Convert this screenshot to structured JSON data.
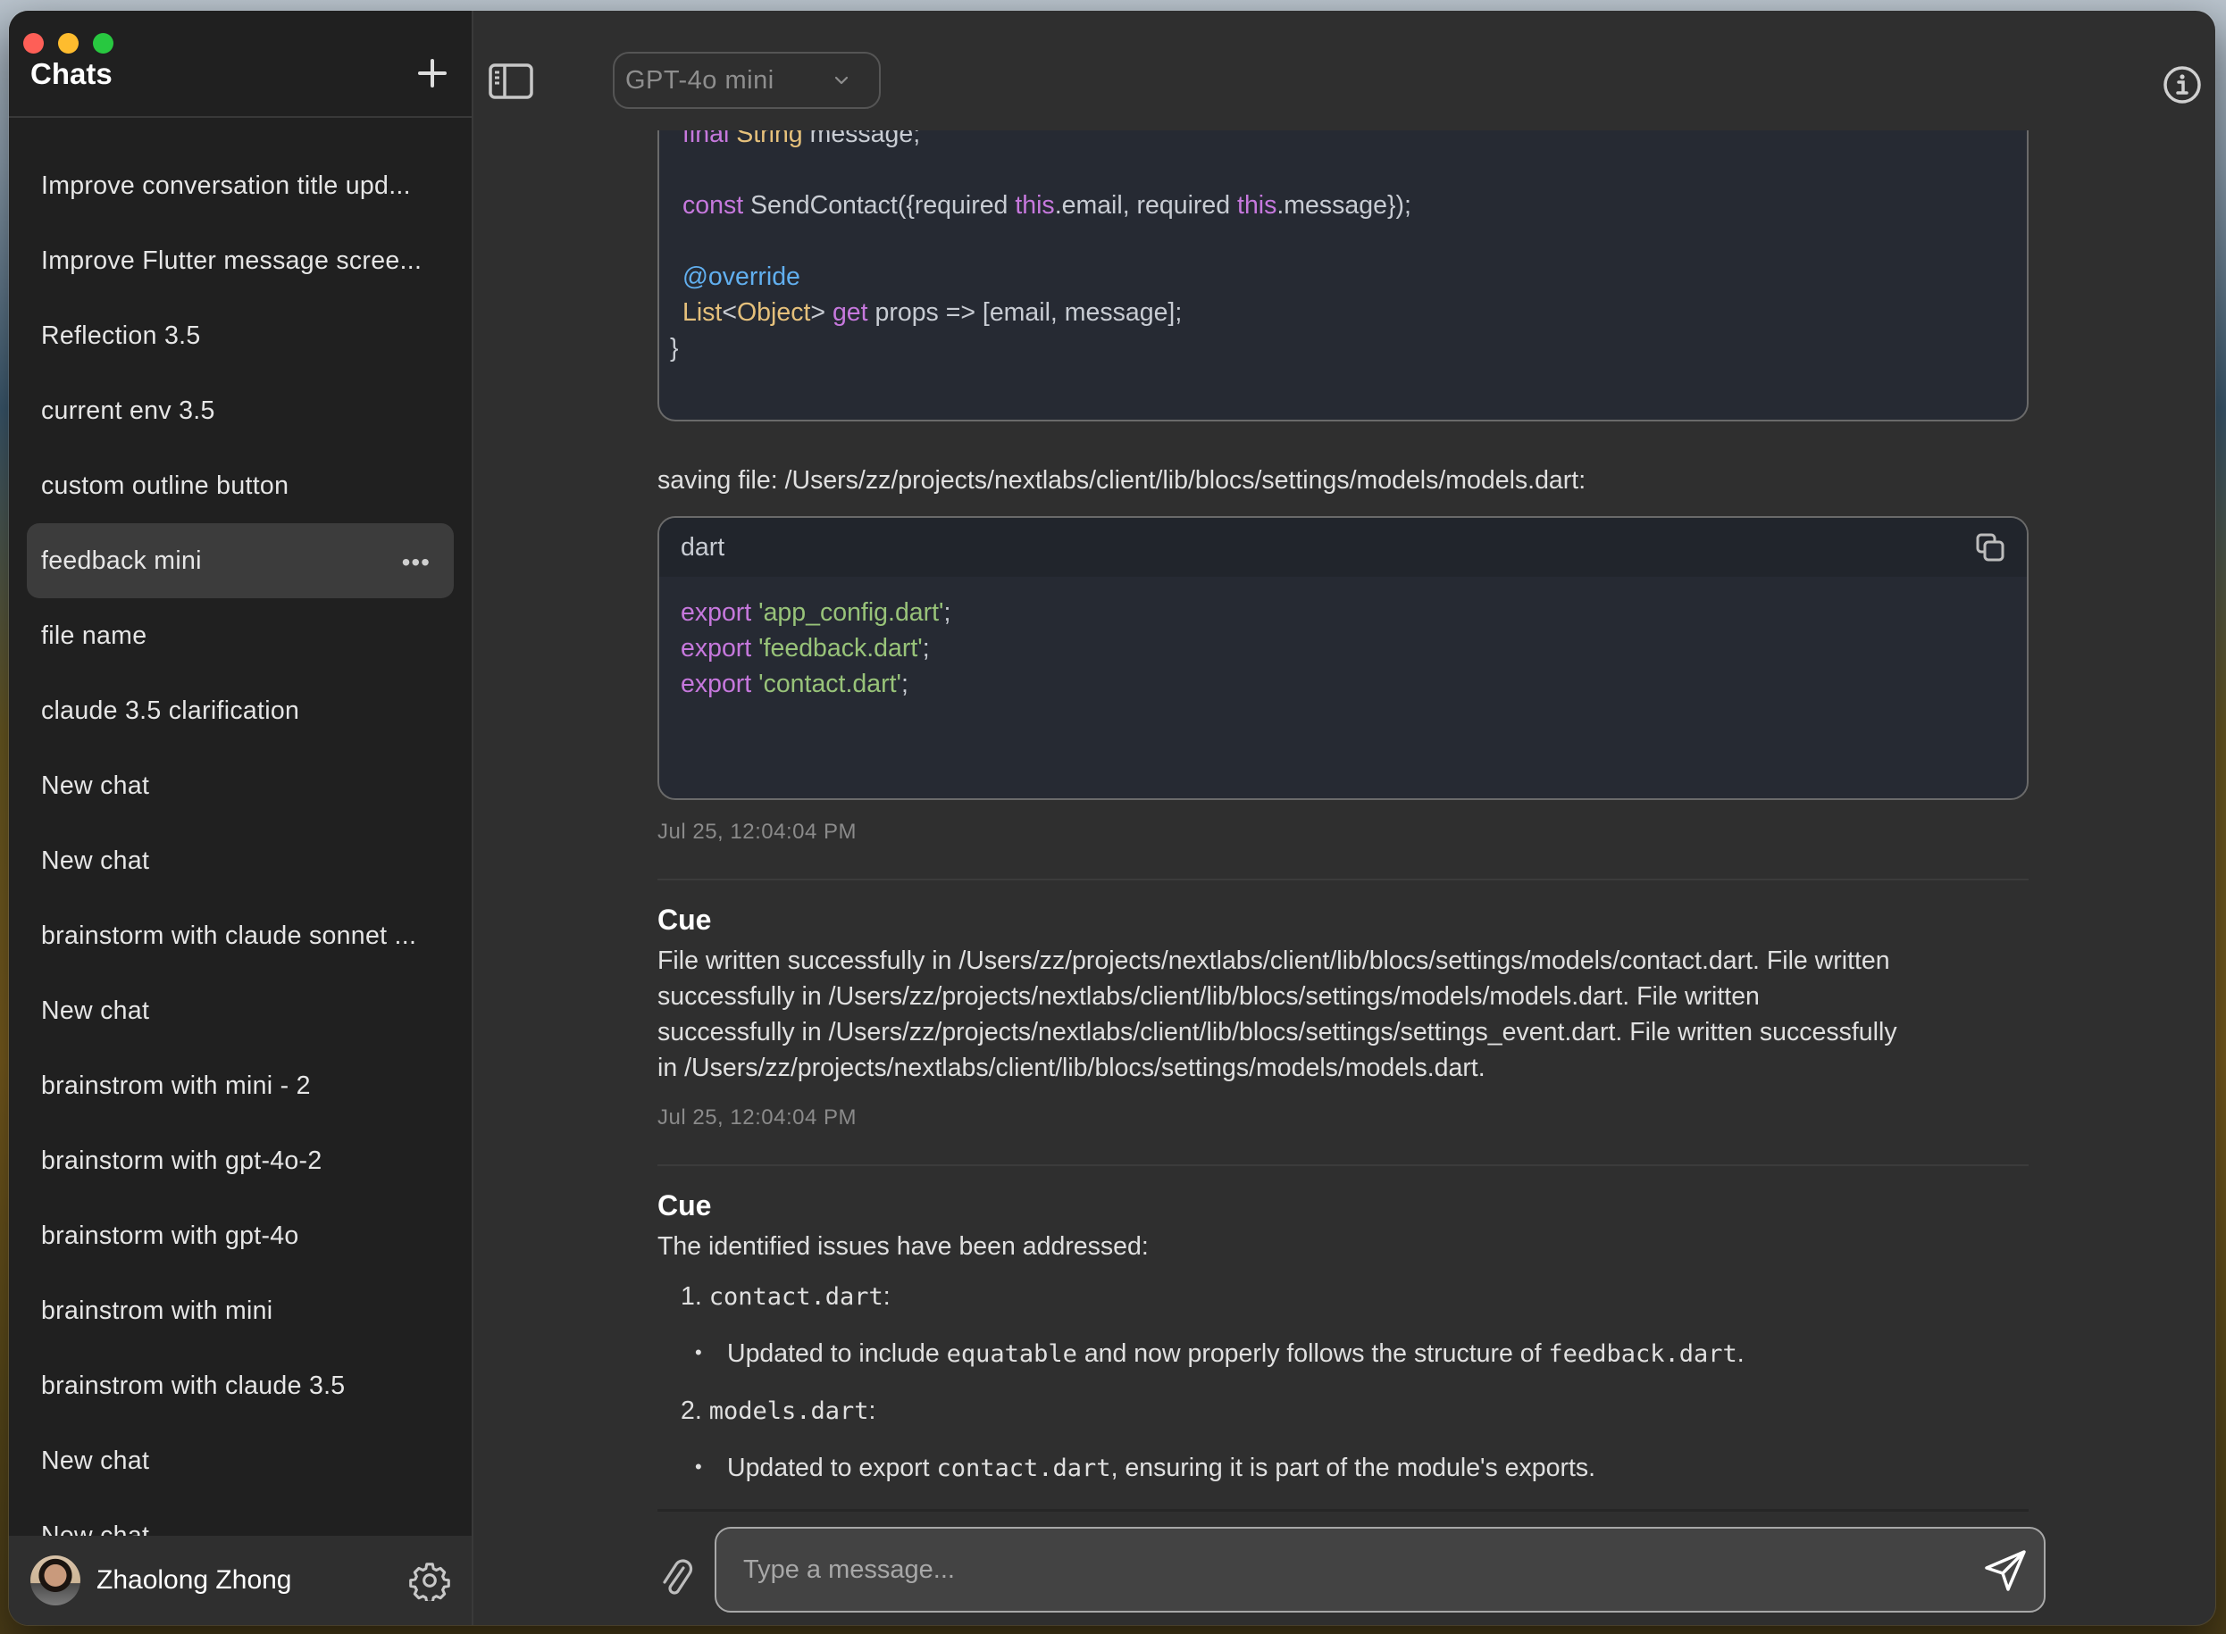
{
  "window": {
    "traffic_lights": [
      "close",
      "minimize",
      "zoom"
    ]
  },
  "sidebar": {
    "title": "Chats",
    "new_chat_icon": "plus-icon",
    "items": [
      {
        "label": "Improve conversation title upd...",
        "active": false
      },
      {
        "label": "Improve Flutter message scree...",
        "active": false
      },
      {
        "label": "Reflection 3.5",
        "active": false
      },
      {
        "label": "current env 3.5",
        "active": false
      },
      {
        "label": "custom outline button",
        "active": false
      },
      {
        "label": "feedback mini",
        "active": true,
        "more_icon": "•••"
      },
      {
        "label": "file name",
        "active": false
      },
      {
        "label": "claude 3.5 clarification",
        "active": false
      },
      {
        "label": "New chat",
        "active": false
      },
      {
        "label": "New chat",
        "active": false
      },
      {
        "label": "brainstorm with claude sonnet ...",
        "active": false
      },
      {
        "label": "New chat",
        "active": false
      },
      {
        "label": "brainstrom with mini - 2",
        "active": false
      },
      {
        "label": "brainstorm with gpt-4o-2",
        "active": false
      },
      {
        "label": "brainstorm with gpt-4o",
        "active": false
      },
      {
        "label": "brainstrom with mini",
        "active": false
      },
      {
        "label": "brainstrom with claude 3.5",
        "active": false
      },
      {
        "label": "New chat",
        "active": false
      },
      {
        "label": "New chat",
        "active": false
      }
    ],
    "user": {
      "name": "Zhaolong Zhong",
      "settings_icon": "gear-icon"
    }
  },
  "header": {
    "model_selected": "GPT-4o mini",
    "sidebar_toggle_icon": "sidebar-icon",
    "info_icon": "info-icon"
  },
  "conversation": {
    "code_block_1": {
      "lines": [
        [
          {
            "t": "final ",
            "c": "kw"
          },
          {
            "t": "String",
            "c": "ty"
          },
          {
            "t": " message;",
            "c": ""
          }
        ],
        [],
        [
          {
            "t": "const ",
            "c": "kw"
          },
          {
            "t": "SendContact({required ",
            "c": ""
          },
          {
            "t": "this",
            "c": "kw"
          },
          {
            "t": ".email, required ",
            "c": ""
          },
          {
            "t": "this",
            "c": "kw"
          },
          {
            "t": ".message});",
            "c": ""
          }
        ],
        [],
        [
          {
            "t": "@override",
            "c": "an"
          }
        ],
        [
          {
            "t": "List",
            "c": "ty"
          },
          {
            "t": "<",
            "c": ""
          },
          {
            "t": "Object",
            "c": "ty"
          },
          {
            "t": "> ",
            "c": ""
          },
          {
            "t": "get",
            "c": "kw"
          },
          {
            "t": " props => [email, message];",
            "c": ""
          }
        ],
        [
          {
            "t": "}",
            "c": "",
            "outdent": true
          }
        ]
      ]
    },
    "saving_text": "saving file: /Users/zz/projects/nextlabs/client/lib/blocs/settings/models/models.dart:",
    "code_block_2": {
      "language": "dart",
      "copy_icon": "copy-icon",
      "lines": [
        [
          {
            "t": "export ",
            "c": "kw"
          },
          {
            "t": "'app_config.dart'",
            "c": "str"
          },
          {
            "t": ";",
            "c": ""
          }
        ],
        [
          {
            "t": "export ",
            "c": "kw"
          },
          {
            "t": "'feedback.dart'",
            "c": "str"
          },
          {
            "t": ";",
            "c": ""
          }
        ],
        [
          {
            "t": "export ",
            "c": "kw"
          },
          {
            "t": "'contact.dart'",
            "c": "str"
          },
          {
            "t": ";",
            "c": ""
          }
        ]
      ]
    },
    "timestamp_1": "Jul 25, 12:04:04 PM",
    "message_1": {
      "sender": "Cue",
      "lines": [
        "File written successfully in /Users/zz/projects/nextlabs/client/lib/blocs/settings/models/contact.dart. File written",
        "successfully in /Users/zz/projects/nextlabs/client/lib/blocs/settings/models/models.dart. File written",
        "successfully in /Users/zz/projects/nextlabs/client/lib/blocs/settings/settings_event.dart. File written successfully",
        "in /Users/zz/projects/nextlabs/client/lib/blocs/settings/models/models.dart."
      ],
      "timestamp": "Jul 25, 12:04:04 PM"
    },
    "message_2": {
      "sender": "Cue",
      "intro": "The identified issues have been addressed:",
      "items": [
        {
          "number": "1.",
          "file": "contact.dart",
          "suffix": ":",
          "bullet": {
            "pre": "Updated to include ",
            "code1": "equatable",
            "mid": " and now properly follows the structure of ",
            "code2": "feedback.dart",
            "post": "."
          }
        },
        {
          "number": "2.",
          "file": "models.dart",
          "suffix": ":",
          "bullet": {
            "pre": "Updated to export ",
            "code1": "contact.dart",
            "mid": ", ensuring it is part of the module's exports.",
            "code2": "",
            "post": ""
          }
        }
      ]
    }
  },
  "composer": {
    "placeholder": "Type a message...",
    "value": "",
    "attach_icon": "paperclip-icon",
    "send_icon": "send-icon"
  }
}
